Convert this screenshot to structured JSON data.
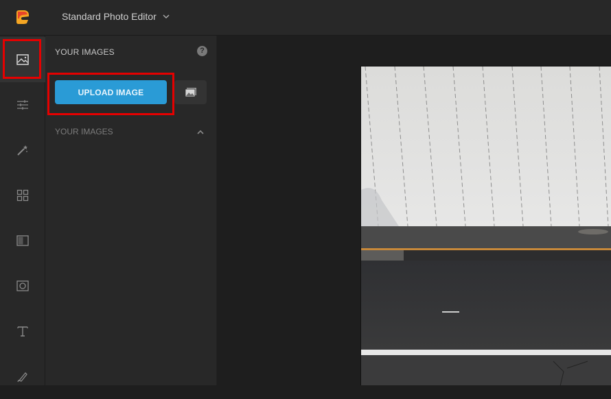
{
  "header": {
    "app_title": "Standard Photo Editor",
    "logo_color": "#f5a623",
    "logo_accent": "#e8442a"
  },
  "toolbar": {
    "items": [
      {
        "name": "images",
        "icon": "image-icon",
        "active": true
      },
      {
        "name": "adjust",
        "icon": "sliders-icon",
        "active": false
      },
      {
        "name": "effects",
        "icon": "magic-wand-icon",
        "active": false
      },
      {
        "name": "templates",
        "icon": "grid-icon",
        "active": false
      },
      {
        "name": "overlays",
        "icon": "texture-icon",
        "active": false
      },
      {
        "name": "frames",
        "icon": "frame-icon",
        "active": false
      },
      {
        "name": "text",
        "icon": "text-icon",
        "active": false
      },
      {
        "name": "draw",
        "icon": "brush-icon",
        "active": false
      }
    ]
  },
  "panel": {
    "title": "YOUR IMAGES",
    "help_label": "?",
    "upload_label": "UPLOAD IMAGE",
    "section_title": "YOUR IMAGES",
    "accent_color": "#2a9bd6"
  },
  "annotations": {
    "highlight_color": "#e60000"
  }
}
